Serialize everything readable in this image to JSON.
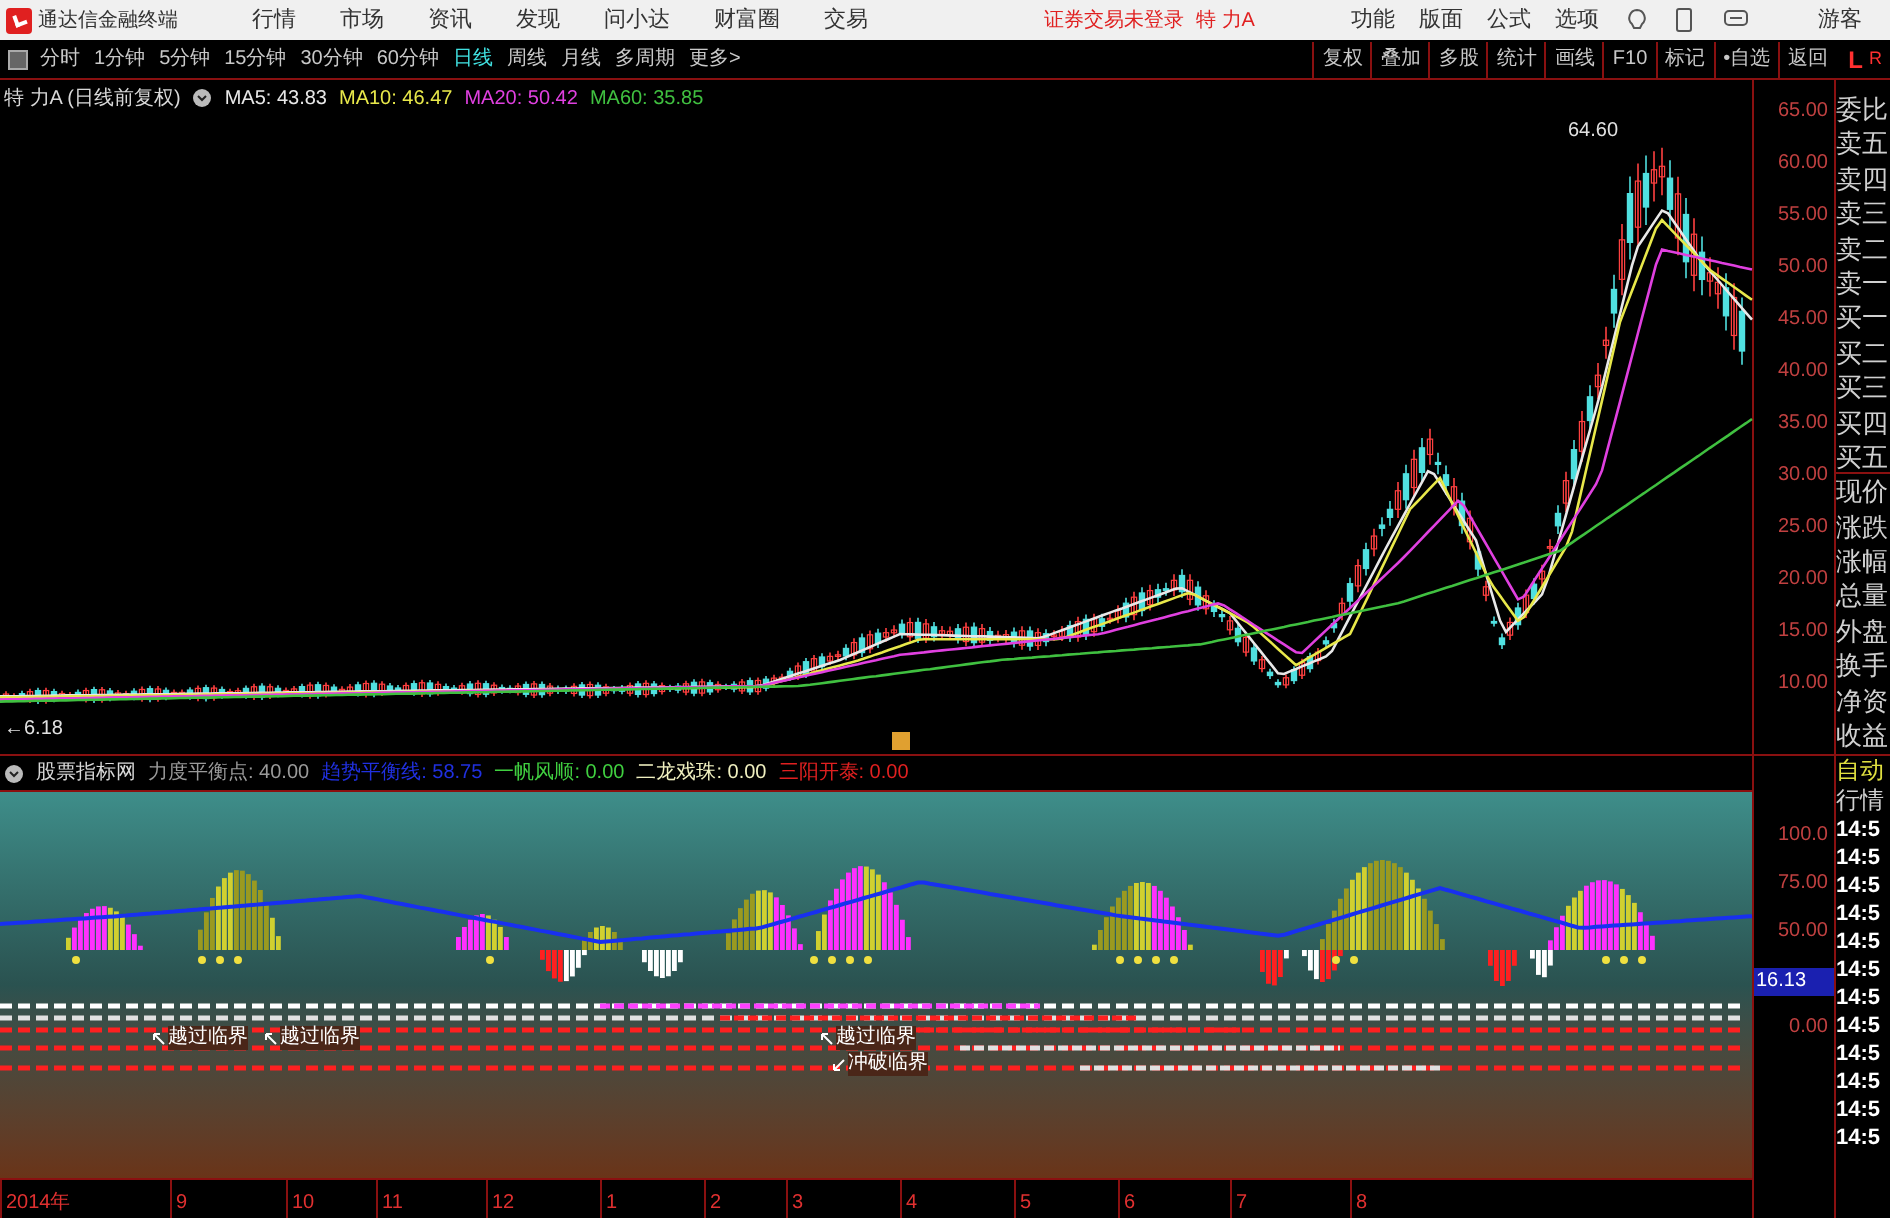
{
  "title_bar": {
    "app_name": "通达信金融终端",
    "menus": [
      "行情",
      "市场",
      "资讯",
      "发现",
      "问小达",
      "财富圈",
      "交易"
    ],
    "login_status": "证券交易未登录",
    "stock": "特 力A",
    "tools": [
      "功能",
      "版面",
      "公式",
      "选项"
    ],
    "user": "游客"
  },
  "toolbar": {
    "periods": [
      {
        "label": "分时",
        "selected": false
      },
      {
        "label": "1分钟",
        "selected": false
      },
      {
        "label": "5分钟",
        "selected": false
      },
      {
        "label": "15分钟",
        "selected": false
      },
      {
        "label": "30分钟",
        "selected": false
      },
      {
        "label": "60分钟",
        "selected": false
      },
      {
        "label": "日线",
        "selected": true
      },
      {
        "label": "周线",
        "selected": false
      },
      {
        "label": "月线",
        "selected": false
      },
      {
        "label": "多周期",
        "selected": false
      },
      {
        "label": "更多>",
        "selected": false
      }
    ],
    "actions": [
      "复权",
      "叠加",
      "多股",
      "统计",
      "画线",
      "F10",
      "标记",
      "•自选",
      "返回"
    ],
    "markers": [
      "L",
      "R"
    ]
  },
  "price_chart": {
    "title": "特 力A (日线前复权)",
    "ma": [
      {
        "label": "MA5: 43.83",
        "color": "#e8e8e8"
      },
      {
        "label": "MA10: 46.47",
        "color": "#e8e84a"
      },
      {
        "label": "MA20: 50.42",
        "color": "#e040e0"
      },
      {
        "label": "MA60: 35.85",
        "color": "#40c040"
      }
    ],
    "high_label": "64.60",
    "low_label": "←6.18",
    "axis": [
      "65.00",
      "60.00",
      "55.00",
      "50.00",
      "45.00",
      "40.00",
      "35.00",
      "30.00",
      "25.00",
      "20.00",
      "15.00",
      "10.00"
    ]
  },
  "indicator": {
    "name": "股票指标网",
    "values": [
      {
        "label": "力度平衡点: 40.00",
        "color": "#9a9a9a"
      },
      {
        "label": "趋势平衡线: 58.75",
        "color": "#2030e0"
      },
      {
        "label": "一帆风顺: 0.00",
        "color": "#40d040"
      },
      {
        "label": "二龙戏珠: 0.00",
        "color": "#f0f0c0"
      },
      {
        "label": "三阳开泰: 0.00",
        "color": "#e02020"
      }
    ],
    "axis": [
      "100.0",
      "75.00",
      "50.00",
      "16.13",
      "0.00"
    ],
    "signals": [
      {
        "label": "越过临界",
        "kind": "up"
      },
      {
        "label": "越过临界",
        "kind": "up"
      },
      {
        "label": "越过临界",
        "kind": "up"
      },
      {
        "label": "冲破临界",
        "kind": "down"
      }
    ]
  },
  "date_axis": [
    "2014年",
    "9",
    "10",
    "11",
    "12",
    "1",
    "2",
    "3",
    "4",
    "5",
    "6",
    "7",
    "8"
  ],
  "quote_panel": {
    "fields": [
      "委比",
      "卖五",
      "卖四",
      "卖三",
      "卖二",
      "卖一",
      "买一",
      "买二",
      "买三",
      "买四",
      "买五",
      "现价",
      "涨跌",
      "涨幅",
      "总量",
      "外盘",
      "换手",
      "净资",
      "收益"
    ],
    "tabs": [
      {
        "label": "自动",
        "selected": true
      },
      {
        "label": "行情",
        "selected": false
      }
    ],
    "times": [
      "14:5",
      "14:5",
      "14:5",
      "14:5",
      "14:5",
      "14:5",
      "14:5",
      "14:5",
      "14:5",
      "14:5",
      "14:5",
      "14:5"
    ]
  }
}
